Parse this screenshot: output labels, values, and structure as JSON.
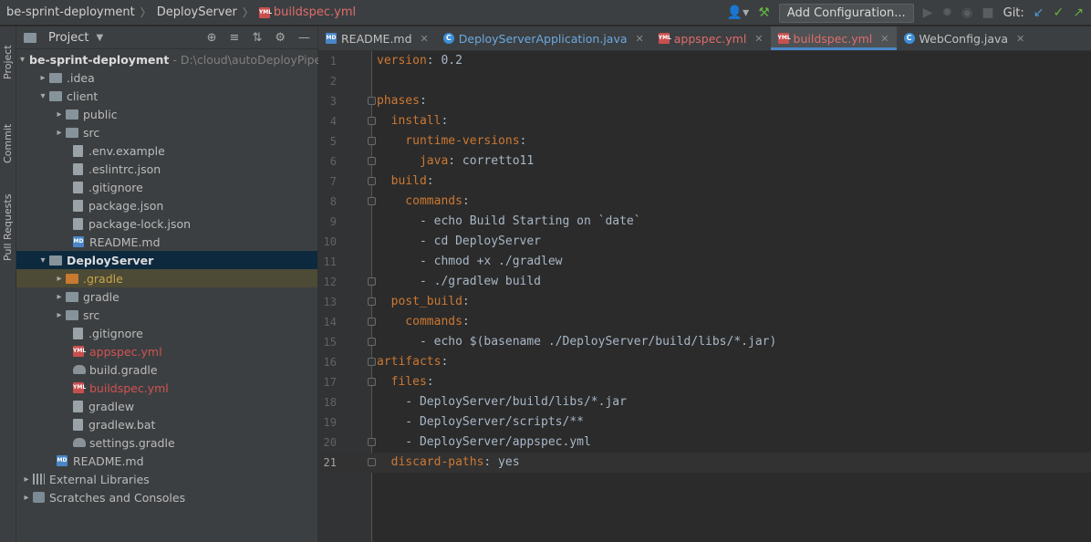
{
  "breadcrumb": {
    "project": "be-sprint-deployment",
    "module": "DeployServer",
    "file": "buildspec.yml"
  },
  "toolbar": {
    "add_configuration": "Add Configuration...",
    "git_label": "Git:"
  },
  "side_tabs": {
    "project": "Project",
    "commit": "Commit",
    "pull_requests": "Pull Requests"
  },
  "project_panel": {
    "title": "Project",
    "tree": [
      {
        "label": "be-sprint-deployment",
        "path": "D:\\cloud\\autoDeployPipe"
      },
      {
        "label": ".idea"
      },
      {
        "label": "client"
      },
      {
        "label": "public"
      },
      {
        "label": "src"
      },
      {
        "label": ".env.example"
      },
      {
        "label": ".eslintrc.json"
      },
      {
        "label": ".gitignore"
      },
      {
        "label": "package.json"
      },
      {
        "label": "package-lock.json"
      },
      {
        "label": "README.md"
      },
      {
        "label": "DeployServer"
      },
      {
        "label": ".gradle"
      },
      {
        "label": "gradle"
      },
      {
        "label": "src"
      },
      {
        "label": ".gitignore"
      },
      {
        "label": "appspec.yml"
      },
      {
        "label": "build.gradle"
      },
      {
        "label": "buildspec.yml"
      },
      {
        "label": "gradlew"
      },
      {
        "label": "gradlew.bat"
      },
      {
        "label": "settings.gradle"
      },
      {
        "label": "README.md"
      },
      {
        "label": "External Libraries"
      },
      {
        "label": "Scratches and Consoles"
      }
    ]
  },
  "editor_tabs": [
    {
      "label": "README.md"
    },
    {
      "label": "DeployServerApplication.java"
    },
    {
      "label": "appspec.yml"
    },
    {
      "label": "buildspec.yml"
    },
    {
      "label": "WebConfig.java"
    }
  ],
  "code_lines": [
    {
      "n": "1",
      "key": "version",
      "rest": ": 0.2"
    },
    {
      "n": "2",
      "key": "",
      "rest": ""
    },
    {
      "n": "3",
      "key": "phases",
      "rest": ":"
    },
    {
      "n": "4",
      "key": "  install",
      "rest": ":"
    },
    {
      "n": "5",
      "key": "    runtime-versions",
      "rest": ":"
    },
    {
      "n": "6",
      "key": "      java",
      "rest": ": corretto11"
    },
    {
      "n": "7",
      "key": "  build",
      "rest": ":"
    },
    {
      "n": "8",
      "key": "    commands",
      "rest": ":"
    },
    {
      "n": "9",
      "key": "",
      "rest": "      - echo Build Starting on `date`"
    },
    {
      "n": "10",
      "key": "",
      "rest": "      - cd DeployServer"
    },
    {
      "n": "11",
      "key": "",
      "rest": "      - chmod +x ./gradlew"
    },
    {
      "n": "12",
      "key": "",
      "rest": "      - ./gradlew build"
    },
    {
      "n": "13",
      "key": "  post_build",
      "rest": ":"
    },
    {
      "n": "14",
      "key": "    commands",
      "rest": ":"
    },
    {
      "n": "15",
      "key": "",
      "rest": "      - echo $(basename ./DeployServer/build/libs/*.jar)"
    },
    {
      "n": "16",
      "key": "artifacts",
      "rest": ":"
    },
    {
      "n": "17",
      "key": "  files",
      "rest": ":"
    },
    {
      "n": "18",
      "key": "",
      "rest": "    - DeployServer/build/libs/*.jar"
    },
    {
      "n": "19",
      "key": "",
      "rest": "    - DeployServer/scripts/**"
    },
    {
      "n": "20",
      "key": "",
      "rest": "    - DeployServer/appspec.yml"
    },
    {
      "n": "21",
      "key": "  discard-paths",
      "rest": ": yes"
    }
  ],
  "colors": {
    "keyword": "#cc7832",
    "text": "#a9b7c6",
    "error_file": "#d25252",
    "selection": "#0d293e"
  }
}
